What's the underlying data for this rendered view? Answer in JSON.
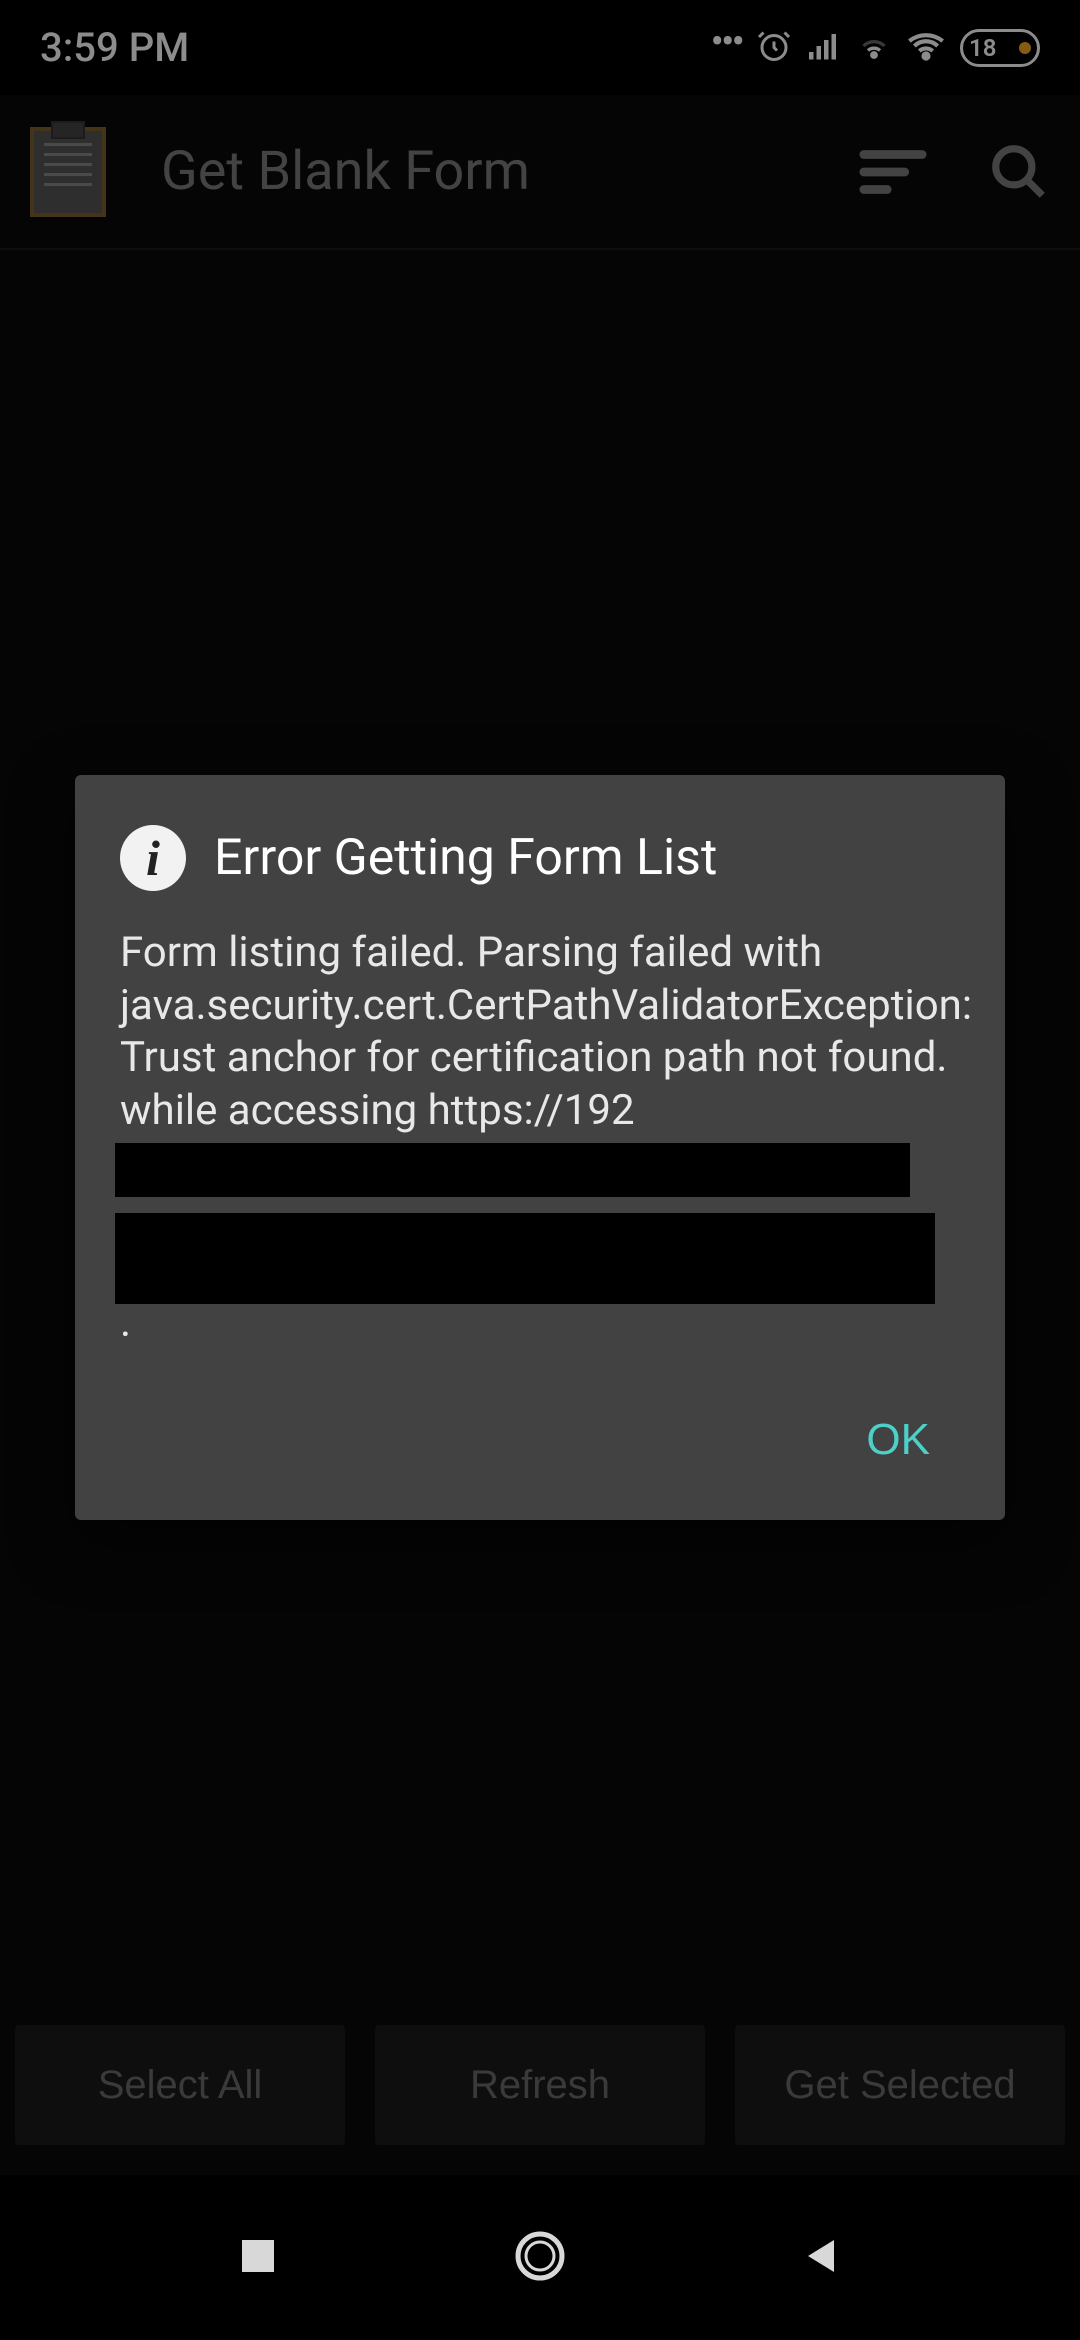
{
  "status": {
    "time": "3:59 PM",
    "battery": "18"
  },
  "appbar": {
    "title": "Get Blank Form"
  },
  "dialog": {
    "title": "Error Getting Form List",
    "body_line1": "Form listing failed. Parsing failed with java.security.cert.CertPathValidatorException: Trust anchor for certification path not found. while accessing https://192",
    "body_end": ".",
    "ok": "OK"
  },
  "buttons": {
    "select_all": "Select All",
    "refresh": "Refresh",
    "get_selected": "Get Selected"
  }
}
